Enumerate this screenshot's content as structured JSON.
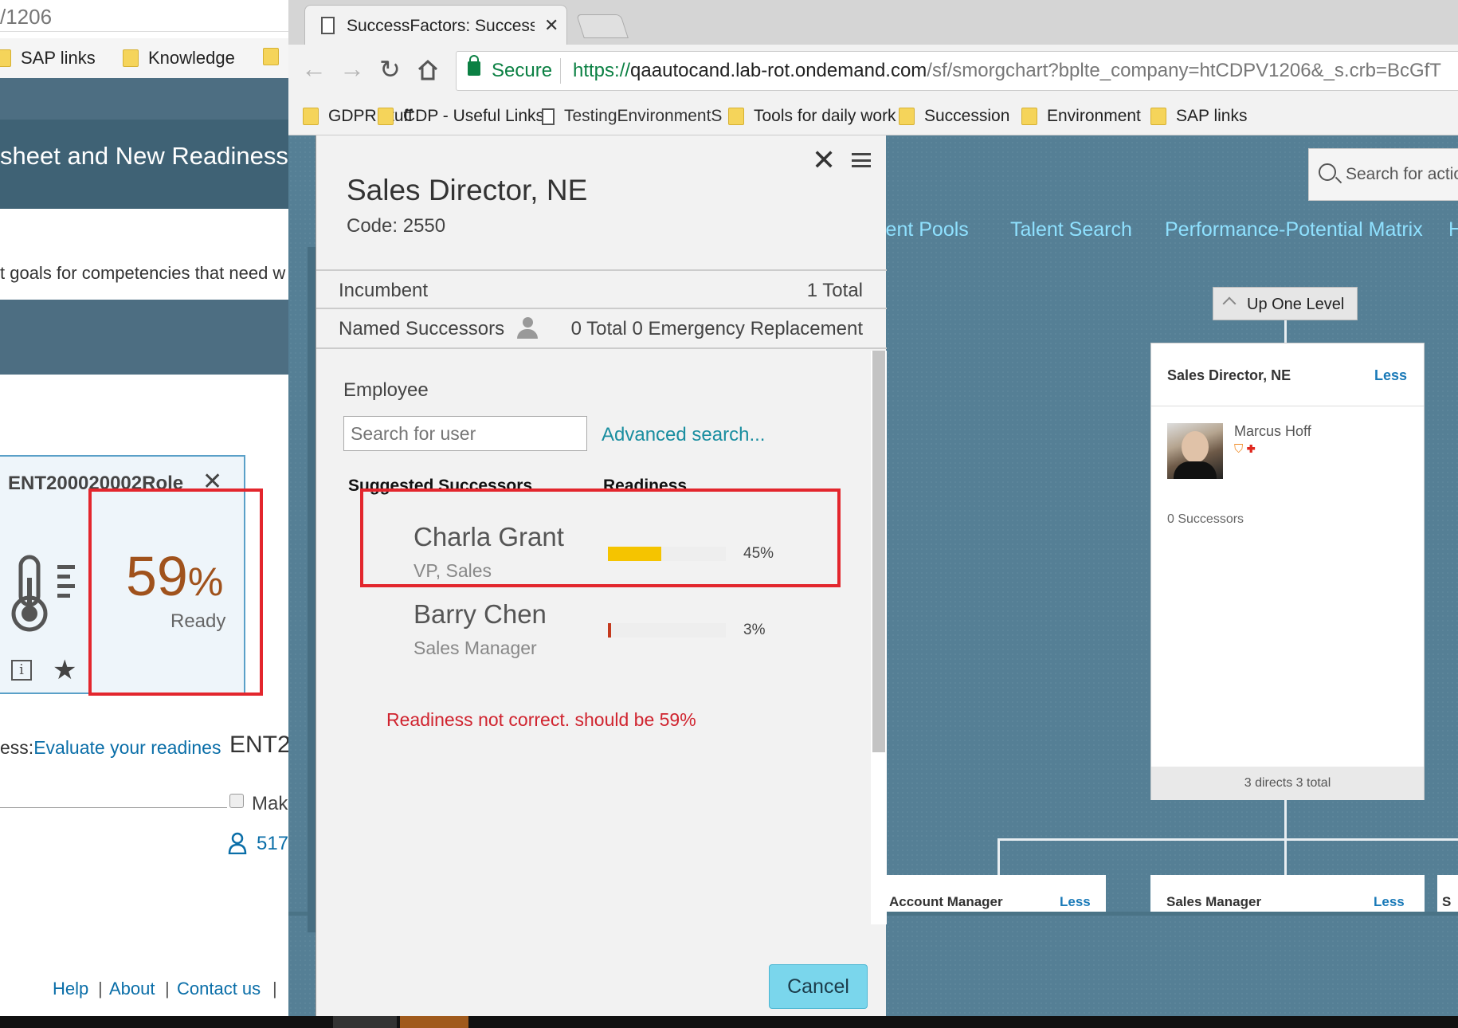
{
  "left_window": {
    "url_fragment": "/1206",
    "bookmarks": [
      "SAP links",
      "Knowledge"
    ],
    "band_title": "sheet and New Readiness",
    "goals_text": "t goals for competencies that need w",
    "card": {
      "title": "ENT200020002Role",
      "percent": "59",
      "percent_sign": "%",
      "ready_label": "Ready"
    },
    "evaluate_prefix": "ess:",
    "evaluate_link": "Evaluate your readines",
    "ent_fragment": "ENT2",
    "checkbox_label": "Mak",
    "user_count": "517",
    "footer": [
      "Help",
      "|",
      "About",
      "|",
      "Contact us",
      "|"
    ]
  },
  "browser": {
    "tab_title": "SuccessFactors: Successio",
    "secure_label": "Secure",
    "url_scheme": "https://",
    "url_host": "qaautocand.lab-rot.ondemand.com",
    "url_path": "/sf/smorgchart?bplte_company=htCDPV1206&_s.crb=BcGfT",
    "bookmarks": [
      {
        "label": "GDPR stuff",
        "icon": "folder"
      },
      {
        "label": "CDP - Useful Links",
        "icon": "folder"
      },
      {
        "label": "TestingEnvironmentS",
        "icon": "page"
      },
      {
        "label": "Tools for daily work",
        "icon": "folder"
      },
      {
        "label": "Succession",
        "icon": "folder"
      },
      {
        "label": "Environment",
        "icon": "folder"
      },
      {
        "label": "SAP links",
        "icon": "folder"
      }
    ]
  },
  "page": {
    "search_placeholder": "Search for actio",
    "nav": [
      "lent Pools",
      "Talent Search",
      "Performance-Potential Matrix",
      "H"
    ],
    "up_level": "Up One Level",
    "org_card": {
      "title": "Sales Director, NE",
      "less": "Less",
      "employee": "Marcus Hoff",
      "successors": "0 Successors",
      "footer": "3 directs 3 total"
    },
    "sub_cards": [
      {
        "title": "Account Manager",
        "less": "Less"
      },
      {
        "title": "Sales Manager",
        "less": "Less"
      },
      {
        "title": "S",
        "less": ""
      }
    ]
  },
  "dialog": {
    "title": "Sales Director, NE",
    "code_label": "Code:",
    "code_value": "2550",
    "incumbent_label": "Incumbent",
    "incumbent_total": "1 Total",
    "named_label": "Named Successors",
    "named_total": "0 Total 0 Emergency Replacement",
    "employee_label": "Employee",
    "search_placeholder": "Search for user",
    "advanced_search": "Advanced search...",
    "col_successors": "Suggested Successors",
    "col_readiness": "Readiness",
    "candidates": [
      {
        "name": "Charla Grant",
        "title": "VP, Sales",
        "readiness": 45,
        "readiness_label": "45%",
        "color": "#f5c400"
      },
      {
        "name": "Barry Chen",
        "title": "Sales Manager",
        "readiness": 3,
        "readiness_label": "3%",
        "color": "#c43a1e"
      }
    ],
    "note": "Readiness not correct. should be 59%",
    "cancel": "Cancel"
  },
  "colors": {
    "annotation_red": "#e3262d",
    "link_teal": "#1a8ea0",
    "nav_cyan": "#8fe1ff",
    "page_blue": "#557f95"
  }
}
